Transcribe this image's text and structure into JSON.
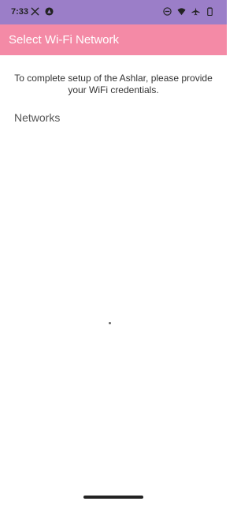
{
  "status_bar": {
    "time": "7:33",
    "left_icons": [
      "x-logo-icon",
      "app-notification-icon"
    ],
    "right_icons": [
      "do-not-disturb-icon",
      "wifi-icon",
      "airplane-mode-icon",
      "battery-icon"
    ],
    "background": "#9b7ec8"
  },
  "app_bar": {
    "title": "Select Wi-Fi Network",
    "background": "#f48aa6"
  },
  "main": {
    "intro": "To complete setup of the Ashlar, please provide your WiFi credentials.",
    "networks_label": "Networks",
    "networks": []
  }
}
